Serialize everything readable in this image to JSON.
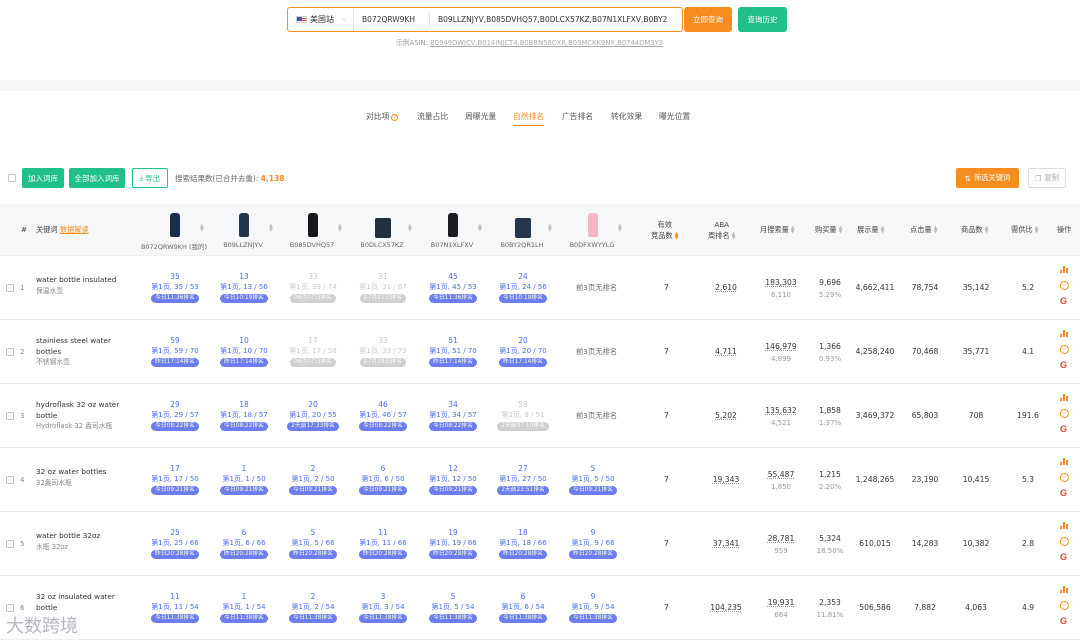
{
  "search": {
    "site": "美国站",
    "main_asin": "B072QRW9KH",
    "asins": "B09LLZNJYV,B085DVHQ57,B0DLCX57KZ,B07N1XLFXV,B0BY2",
    "query_btn": "立即查询",
    "history_btn": "查询历史",
    "example_label": "示例ASIN:",
    "example_asins": "B0949DWJCV,B014INJCT4,B0BRN58CXR,B09MCKK9NX,B0744DM3Y3"
  },
  "tabs": [
    "对比项",
    "流量占比",
    "周曝光量",
    "自然排名",
    "广告排名",
    "转化效果",
    "曝光位置"
  ],
  "active_tab": "自然排名",
  "toolbar": {
    "add_btn": "加入词库",
    "add_all_btn": "全部加入词库",
    "export_btn": "导出",
    "count_label": "搜索结果数(已合并去重):",
    "count": "4,138",
    "filter_btn": "筛选关键词",
    "copy_btn": "复制"
  },
  "headers": {
    "index": "#",
    "keyword": "关键词",
    "analysis": "数据解读",
    "valid": "有效",
    "valid2": "竞品数",
    "aba": "ABA",
    "aba2": "周排名",
    "monthly": "月搜索量",
    "purchase": "购买量",
    "impressions": "展示量",
    "clicks": "点击量",
    "products": "商品数",
    "ratio": "需供比",
    "ops": "操作"
  },
  "products": [
    {
      "asin": "B072QRW9KH (我的)",
      "color": "#1d2d4f"
    },
    {
      "asin": "B09LLZNJYV",
      "color": "#263548"
    },
    {
      "asin": "B085DVHQ57",
      "color": "#15171c"
    },
    {
      "asin": "B0DLCX57KZ",
      "color": "#22303e"
    },
    {
      "asin": "B07N1XLFXV",
      "color": "#1b1d22"
    },
    {
      "asin": "B0BY2QR1LH",
      "color": "#24374f"
    },
    {
      "asin": "B0DFXWYYLG",
      "color": "#f2b8c4"
    }
  ],
  "rows": [
    {
      "idx": "1",
      "kw": "water bottle insulated",
      "cn": "保温水壶",
      "ranks": [
        {
          "n": "35",
          "p": "第1页, 35 / 53",
          "t": "今日11:36排名",
          "gray": false
        },
        {
          "n": "13",
          "p": "第1页, 13 / 56",
          "t": "今日10:19排名",
          "gray": false
        },
        {
          "n": "33",
          "p": "第1页, 33 / 74",
          "t": "06月07日排名",
          "gray": true
        },
        {
          "n": "31",
          "p": "第1页, 31 / 67",
          "t": "07月21日排名",
          "gray": true
        },
        {
          "n": "45",
          "p": "第1页, 45 / 53",
          "t": "今日11:36排名",
          "gray": false
        },
        {
          "n": "24",
          "p": "第1页, 24 / 56",
          "t": "今日10:19排名",
          "gray": false
        }
      ],
      "none": "前3页无排名",
      "valid": "7",
      "aba": "2,610",
      "monthly": "183,303",
      "monthly_sub": "6,110",
      "purchase": "9,696",
      "purchase_sub": "5.29%",
      "impr": "4,662,411",
      "clicks": "78,754",
      "prods": "35,142",
      "ratio": "5.2"
    },
    {
      "idx": "2",
      "kw": "stainless steel water bottles",
      "cn": "不锈钢水壶",
      "ranks": [
        {
          "n": "59",
          "p": "第1页, 59 / 70",
          "t": "昨日17:14排名",
          "gray": false
        },
        {
          "n": "10",
          "p": "第1页, 10 / 70",
          "t": "昨日17:14排名",
          "gray": false
        },
        {
          "n": "17",
          "p": "第1页, 17 / 58",
          "t": "06月07日排名",
          "gray": true
        },
        {
          "n": "33",
          "p": "第1页, 33 / 79",
          "t": "07月28日排名",
          "gray": true
        },
        {
          "n": "51",
          "p": "第1页, 51 / 70",
          "t": "昨日17:14排名",
          "gray": false
        },
        {
          "n": "20",
          "p": "第1页, 20 / 70",
          "t": "昨日17:14排名",
          "gray": false
        }
      ],
      "none": "前3页无排名",
      "valid": "7",
      "aba": "4,711",
      "monthly": "146,979",
      "monthly_sub": "4,899",
      "purchase": "1,366",
      "purchase_sub": "0.93%",
      "impr": "4,258,240",
      "clicks": "70,468",
      "prods": "35,771",
      "ratio": "4.1"
    },
    {
      "idx": "3",
      "kw": "hydroflask 32 oz water bottle",
      "cn": "Hydroflask 32 盎司水瓶",
      "ranks": [
        {
          "n": "29",
          "p": "第1页, 29 / 57",
          "t": "今日08:22排名",
          "gray": false
        },
        {
          "n": "18",
          "p": "第1页, 18 / 57",
          "t": "今日08:22排名",
          "gray": false
        },
        {
          "n": "20",
          "p": "第1页, 20 / 55",
          "t": "2天前17:33排名",
          "gray": false
        },
        {
          "n": "46",
          "p": "第1页, 46 / 57",
          "t": "今日08:22排名",
          "gray": false
        },
        {
          "n": "34",
          "p": "第1页, 34 / 57",
          "t": "今日08:22排名",
          "gray": false
        },
        {
          "n": "59",
          "p": "第2页, 9 / 51",
          "t": "2天前07:10排名",
          "gray": true
        }
      ],
      "none": "前3页无排名",
      "valid": "7",
      "aba": "5,202",
      "monthly": "135,632",
      "monthly_sub": "4,521",
      "purchase": "1,858",
      "purchase_sub": "1.37%",
      "impr": "3,469,372",
      "clicks": "65,803",
      "prods": "708",
      "ratio": "191.6"
    },
    {
      "idx": "4",
      "kw": "32 oz water bottles",
      "cn": "32盎司水瓶",
      "ranks": [
        {
          "n": "17",
          "p": "第1页, 17 / 50",
          "t": "今日09:21排名",
          "gray": false
        },
        {
          "n": "1",
          "p": "第1页, 1 / 50",
          "t": "今日09:21排名",
          "gray": false
        },
        {
          "n": "2",
          "p": "第1页, 2 / 50",
          "t": "今日09:21排名",
          "gray": false
        },
        {
          "n": "6",
          "p": "第1页, 6 / 50",
          "t": "今日09:21排名",
          "gray": false
        },
        {
          "n": "12",
          "p": "第1页, 12 / 50",
          "t": "今日09:21排名",
          "gray": false
        },
        {
          "n": "27",
          "p": "第1页, 27 / 50",
          "t": "2天前23:51排名",
          "gray": false
        },
        {
          "n": "5",
          "p": "第1页, 5 / 50",
          "t": "今日09:21排名",
          "gray": false
        }
      ],
      "none": "",
      "valid": "7",
      "aba": "19,343",
      "monthly": "55,487",
      "monthly_sub": "1,850",
      "purchase": "1,215",
      "purchase_sub": "2.20%",
      "impr": "1,248,265",
      "clicks": "23,190",
      "prods": "10,415",
      "ratio": "5.3"
    },
    {
      "idx": "5",
      "kw": "water bottle 32oz",
      "cn": "水瓶 32oz",
      "ranks": [
        {
          "n": "25",
          "p": "第1页, 25 / 66",
          "t": "昨日20:28排名",
          "gray": false
        },
        {
          "n": "6",
          "p": "第1页, 6 / 66",
          "t": "昨日20:28排名",
          "gray": false
        },
        {
          "n": "5",
          "p": "第1页, 5 / 66",
          "t": "昨日20:28排名",
          "gray": false
        },
        {
          "n": "11",
          "p": "第1页, 11 / 66",
          "t": "昨日20:28排名",
          "gray": false
        },
        {
          "n": "19",
          "p": "第1页, 19 / 66",
          "t": "昨日20:28排名",
          "gray": false
        },
        {
          "n": "18",
          "p": "第1页, 18 / 66",
          "t": "昨日20:28排名",
          "gray": false
        },
        {
          "n": "9",
          "p": "第1页, 9 / 66",
          "t": "昨日20:28排名",
          "gray": false
        }
      ],
      "none": "",
      "valid": "7",
      "aba": "37,341",
      "monthly": "28,781",
      "monthly_sub": "959",
      "purchase": "5,324",
      "purchase_sub": "18.50%",
      "impr": "610,015",
      "clicks": "14,283",
      "prods": "10,382",
      "ratio": "2.8"
    },
    {
      "idx": "6",
      "kw": "32 oz insulated water bottle",
      "cn": "",
      "ranks": [
        {
          "n": "11",
          "p": "第1页, 11 / 54",
          "t": "今日11:38排名",
          "gray": false
        },
        {
          "n": "1",
          "p": "第1页, 1 / 54",
          "t": "今日11:38排名",
          "gray": false
        },
        {
          "n": "2",
          "p": "第1页, 2 / 54",
          "t": "今日11:38排名",
          "gray": false
        },
        {
          "n": "3",
          "p": "第1页, 3 / 54",
          "t": "今日11:38排名",
          "gray": false
        },
        {
          "n": "5",
          "p": "第1页, 5 / 54",
          "t": "今日11:38排名",
          "gray": false
        },
        {
          "n": "6",
          "p": "第1页, 6 / 54",
          "t": "今日11:38排名",
          "gray": false
        },
        {
          "n": "9",
          "p": "第1页, 9 / 54",
          "t": "今日11:38排名",
          "gray": false
        }
      ],
      "none": "",
      "valid": "7",
      "aba": "104,235",
      "monthly": "19,931",
      "monthly_sub": "664",
      "purchase": "2,353",
      "purchase_sub": "11.81%",
      "impr": "506,586",
      "clicks": "7,882",
      "prods": "4,063",
      "ratio": "4.9"
    }
  ],
  "watermark": "大数跨境"
}
